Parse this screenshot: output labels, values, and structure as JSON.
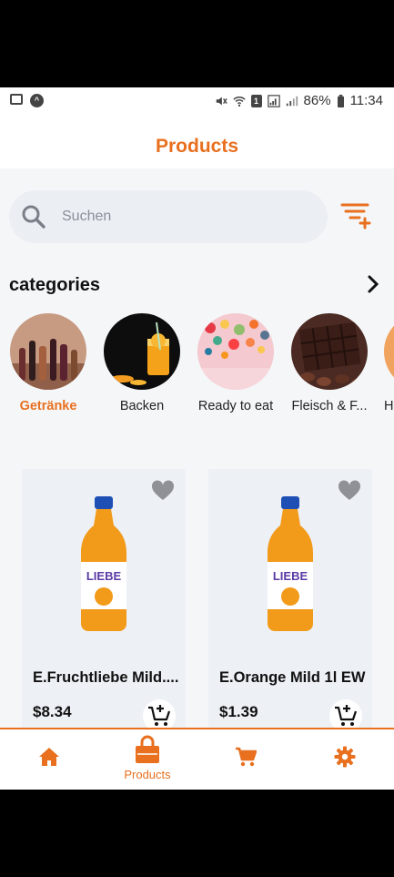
{
  "status_bar": {
    "battery": "86%",
    "time": "11:34",
    "sim_label": "1"
  },
  "header": {
    "title": "Products"
  },
  "search": {
    "placeholder": "Suchen"
  },
  "categories": {
    "title": "categories",
    "items": [
      {
        "label": "Getränke",
        "active": true
      },
      {
        "label": "Backen",
        "active": false
      },
      {
        "label": "Ready to eat",
        "active": false
      },
      {
        "label": "Fleisch & F...",
        "active": false
      },
      {
        "label": "H",
        "active": false
      }
    ]
  },
  "products": [
    {
      "name": "E.Fruchtliebe Mild....",
      "price": "$8.34",
      "bottle_brand": "LIEBE"
    },
    {
      "name": "E.Orange Mild 1l EW",
      "price": "$1.39",
      "bottle_brand": "LIEBE"
    }
  ],
  "bottom_nav": {
    "items": [
      {
        "icon": "home-icon",
        "label": ""
      },
      {
        "icon": "shopping-bag-icon",
        "label": "Products"
      },
      {
        "icon": "cart-icon",
        "label": ""
      },
      {
        "icon": "gear-icon",
        "label": ""
      }
    ]
  },
  "colors": {
    "accent": "#e8701f",
    "card_bg": "#edf0f5",
    "search_bg": "#ebeef3"
  }
}
